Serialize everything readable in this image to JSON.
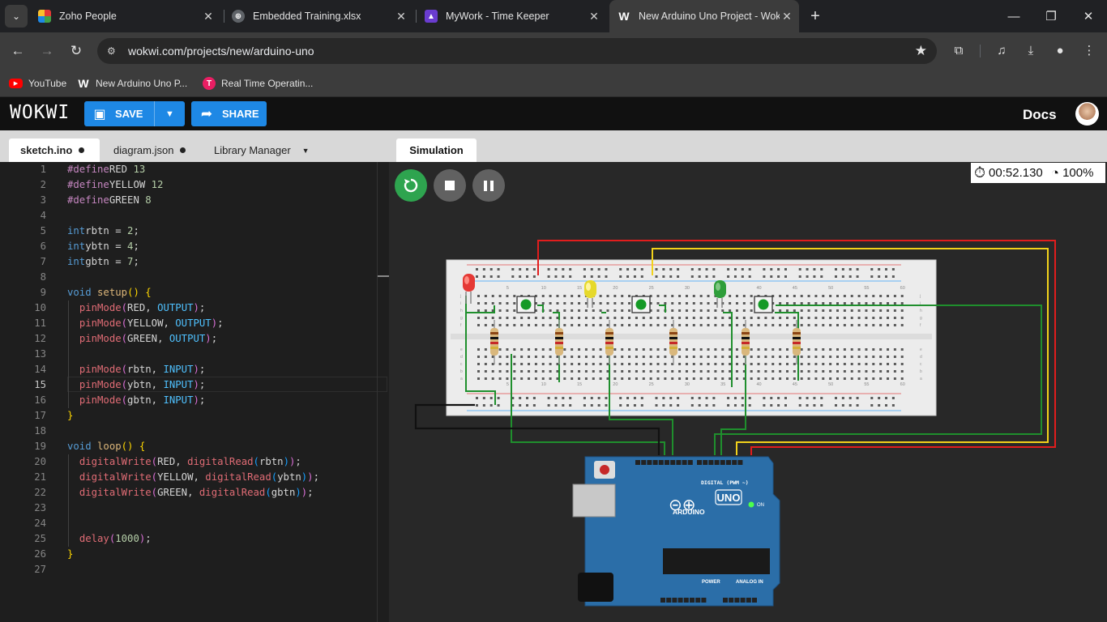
{
  "browser": {
    "tabs": [
      {
        "title": "Zoho People",
        "icon": "zoho-icon",
        "color": "#3e7bfa"
      },
      {
        "title": "Embedded Training.xlsx",
        "icon": "globe-icon",
        "color": "#9aa0a6"
      },
      {
        "title": "MyWork - Time Keeper",
        "icon": "mywork-icon",
        "color": "#6a3ccf"
      },
      {
        "title": "New Arduino Uno Project - Wokwi",
        "icon": "wokwi-icon",
        "color": "#ffffff",
        "active": true
      }
    ],
    "url": "wokwi.com/projects/new/arduino-uno",
    "bookmarks": [
      {
        "label": "YouTube",
        "icon": "youtube-icon",
        "color": "#ff0000"
      },
      {
        "label": "New Arduino Uno P...",
        "icon": "wokwi-icon",
        "color": "#ffffff"
      },
      {
        "label": "Real Time Operatin...",
        "icon": "t-logo-icon",
        "color": "#e91e63"
      }
    ]
  },
  "wokwi": {
    "logo": "WOKWI",
    "save_label": "SAVE",
    "share_label": "SHARE",
    "docs_label": "Docs",
    "accent": "#1e88e5",
    "editor_tabs": [
      {
        "label": "sketch.ino",
        "modified": true,
        "active": true
      },
      {
        "label": "diagram.json",
        "modified": true
      },
      {
        "label": "Library Manager",
        "dropdown": true
      }
    ],
    "sim_tab": "Simulation",
    "timer": "00:52.130",
    "speed": "100%",
    "cursor_line": 15
  },
  "code": [
    [
      [
        "mac",
        "#define"
      ],
      [
        "",
        "RED "
      ],
      [
        "num",
        "13"
      ]
    ],
    [
      [
        "mac",
        "#define"
      ],
      [
        "",
        "YELLOW "
      ],
      [
        "num",
        "12"
      ]
    ],
    [
      [
        "mac",
        "#define"
      ],
      [
        "",
        "GREEN "
      ],
      [
        "num",
        "8"
      ]
    ],
    [],
    [
      [
        "ty",
        "int"
      ],
      [
        "",
        "rbtn = "
      ],
      [
        "num",
        "2"
      ],
      [
        "",
        ";"
      ]
    ],
    [
      [
        "ty",
        "int"
      ],
      [
        "",
        "ybtn = "
      ],
      [
        "num",
        "4"
      ],
      [
        "",
        ";"
      ]
    ],
    [
      [
        "ty",
        "int"
      ],
      [
        "",
        "gbtn = "
      ],
      [
        "num",
        "7"
      ],
      [
        "",
        ";"
      ]
    ],
    [],
    [
      [
        "kw",
        "void"
      ],
      [
        "",
        " "
      ],
      [
        "fl",
        "setup"
      ],
      [
        "p1",
        "()"
      ],
      [
        "",
        " "
      ],
      [
        "p1",
        "{"
      ]
    ],
    [
      [
        "",
        "  "
      ],
      [
        "pm",
        "pinMode"
      ],
      [
        "p2",
        "("
      ],
      [
        "",
        "RED, "
      ],
      [
        "ct",
        "OUTPUT"
      ],
      [
        "p2",
        ")"
      ],
      [
        "",
        ";"
      ]
    ],
    [
      [
        "",
        "  "
      ],
      [
        "pm",
        "pinMode"
      ],
      [
        "p2",
        "("
      ],
      [
        "",
        "YELLOW, "
      ],
      [
        "ct",
        "OUTPUT"
      ],
      [
        "p2",
        ")"
      ],
      [
        "",
        ";"
      ]
    ],
    [
      [
        "",
        "  "
      ],
      [
        "pm",
        "pinMode"
      ],
      [
        "p2",
        "("
      ],
      [
        "",
        "GREEN, "
      ],
      [
        "ct",
        "OUTPUT"
      ],
      [
        "p2",
        ")"
      ],
      [
        "",
        ";"
      ]
    ],
    [],
    [
      [
        "",
        "  "
      ],
      [
        "pm",
        "pinMode"
      ],
      [
        "p2",
        "("
      ],
      [
        "",
        "rbtn, "
      ],
      [
        "ct",
        "INPUT"
      ],
      [
        "p2",
        ")"
      ],
      [
        "",
        ";"
      ]
    ],
    [
      [
        "",
        "  "
      ],
      [
        "pm",
        "pinMode"
      ],
      [
        "p2",
        "("
      ],
      [
        "",
        "ybtn, "
      ],
      [
        "ct",
        "INPUT"
      ],
      [
        "p2",
        ")"
      ],
      [
        "",
        ";"
      ]
    ],
    [
      [
        "",
        "  "
      ],
      [
        "pm",
        "pinMode"
      ],
      [
        "p2",
        "("
      ],
      [
        "",
        "gbtn, "
      ],
      [
        "ct",
        "INPUT"
      ],
      [
        "p2",
        ")"
      ],
      [
        "",
        ";"
      ]
    ],
    [
      [
        "p1",
        "}"
      ]
    ],
    [],
    [
      [
        "kw",
        "void"
      ],
      [
        "",
        " "
      ],
      [
        "fl",
        "loop"
      ],
      [
        "p1",
        "()"
      ],
      [
        "",
        " "
      ],
      [
        "p1",
        "{"
      ]
    ],
    [
      [
        "",
        "  "
      ],
      [
        "pm",
        "digitalWrite"
      ],
      [
        "p2",
        "("
      ],
      [
        "",
        "RED, "
      ],
      [
        "pm",
        "digitalRead"
      ],
      [
        "p3",
        "("
      ],
      [
        "",
        "rbtn"
      ],
      [
        "p3",
        ")"
      ],
      [
        "p2",
        ")"
      ],
      [
        "",
        ";"
      ]
    ],
    [
      [
        "",
        "  "
      ],
      [
        "pm",
        "digitalWrite"
      ],
      [
        "p2",
        "("
      ],
      [
        "",
        "YELLOW, "
      ],
      [
        "pm",
        "digitalRead"
      ],
      [
        "p3",
        "("
      ],
      [
        "",
        "ybtn"
      ],
      [
        "p3",
        ")"
      ],
      [
        "p2",
        ")"
      ],
      [
        "",
        ";"
      ]
    ],
    [
      [
        "",
        "  "
      ],
      [
        "pm",
        "digitalWrite"
      ],
      [
        "p2",
        "("
      ],
      [
        "",
        "GREEN, "
      ],
      [
        "pm",
        "digitalRead"
      ],
      [
        "p3",
        "("
      ],
      [
        "",
        "gbtn"
      ],
      [
        "p3",
        ")"
      ],
      [
        "p2",
        ")"
      ],
      [
        "",
        ";"
      ]
    ],
    [],
    [],
    [
      [
        "",
        "  "
      ],
      [
        "pm",
        "delay"
      ],
      [
        "p2",
        "("
      ],
      [
        "num",
        "1000"
      ],
      [
        "p2",
        ")"
      ],
      [
        "",
        ";"
      ]
    ],
    [
      [
        "p1",
        "}"
      ]
    ],
    []
  ],
  "breadboard": {
    "column_numbers": [
      "5",
      "10",
      "15",
      "20",
      "25",
      "30",
      "35",
      "40",
      "45",
      "50",
      "55",
      "60"
    ],
    "row_letters": [
      "a",
      "b",
      "c",
      "d",
      "e",
      "f",
      "g",
      "h",
      "i",
      "j"
    ],
    "leds": [
      {
        "color": "#e53935",
        "name": "red-led"
      },
      {
        "color": "#e6d92b",
        "name": "yellow-led"
      },
      {
        "color": "#2e9e3a",
        "name": "green-led"
      }
    ]
  },
  "arduino": {
    "brand": "ARDUINO",
    "model": "UNO",
    "on_label": "ON",
    "digital_label": "DIGITAL (PWM ~)",
    "power_label": "POWER",
    "analog_label": "ANALOG IN",
    "board_color": "#2b6ea8"
  }
}
